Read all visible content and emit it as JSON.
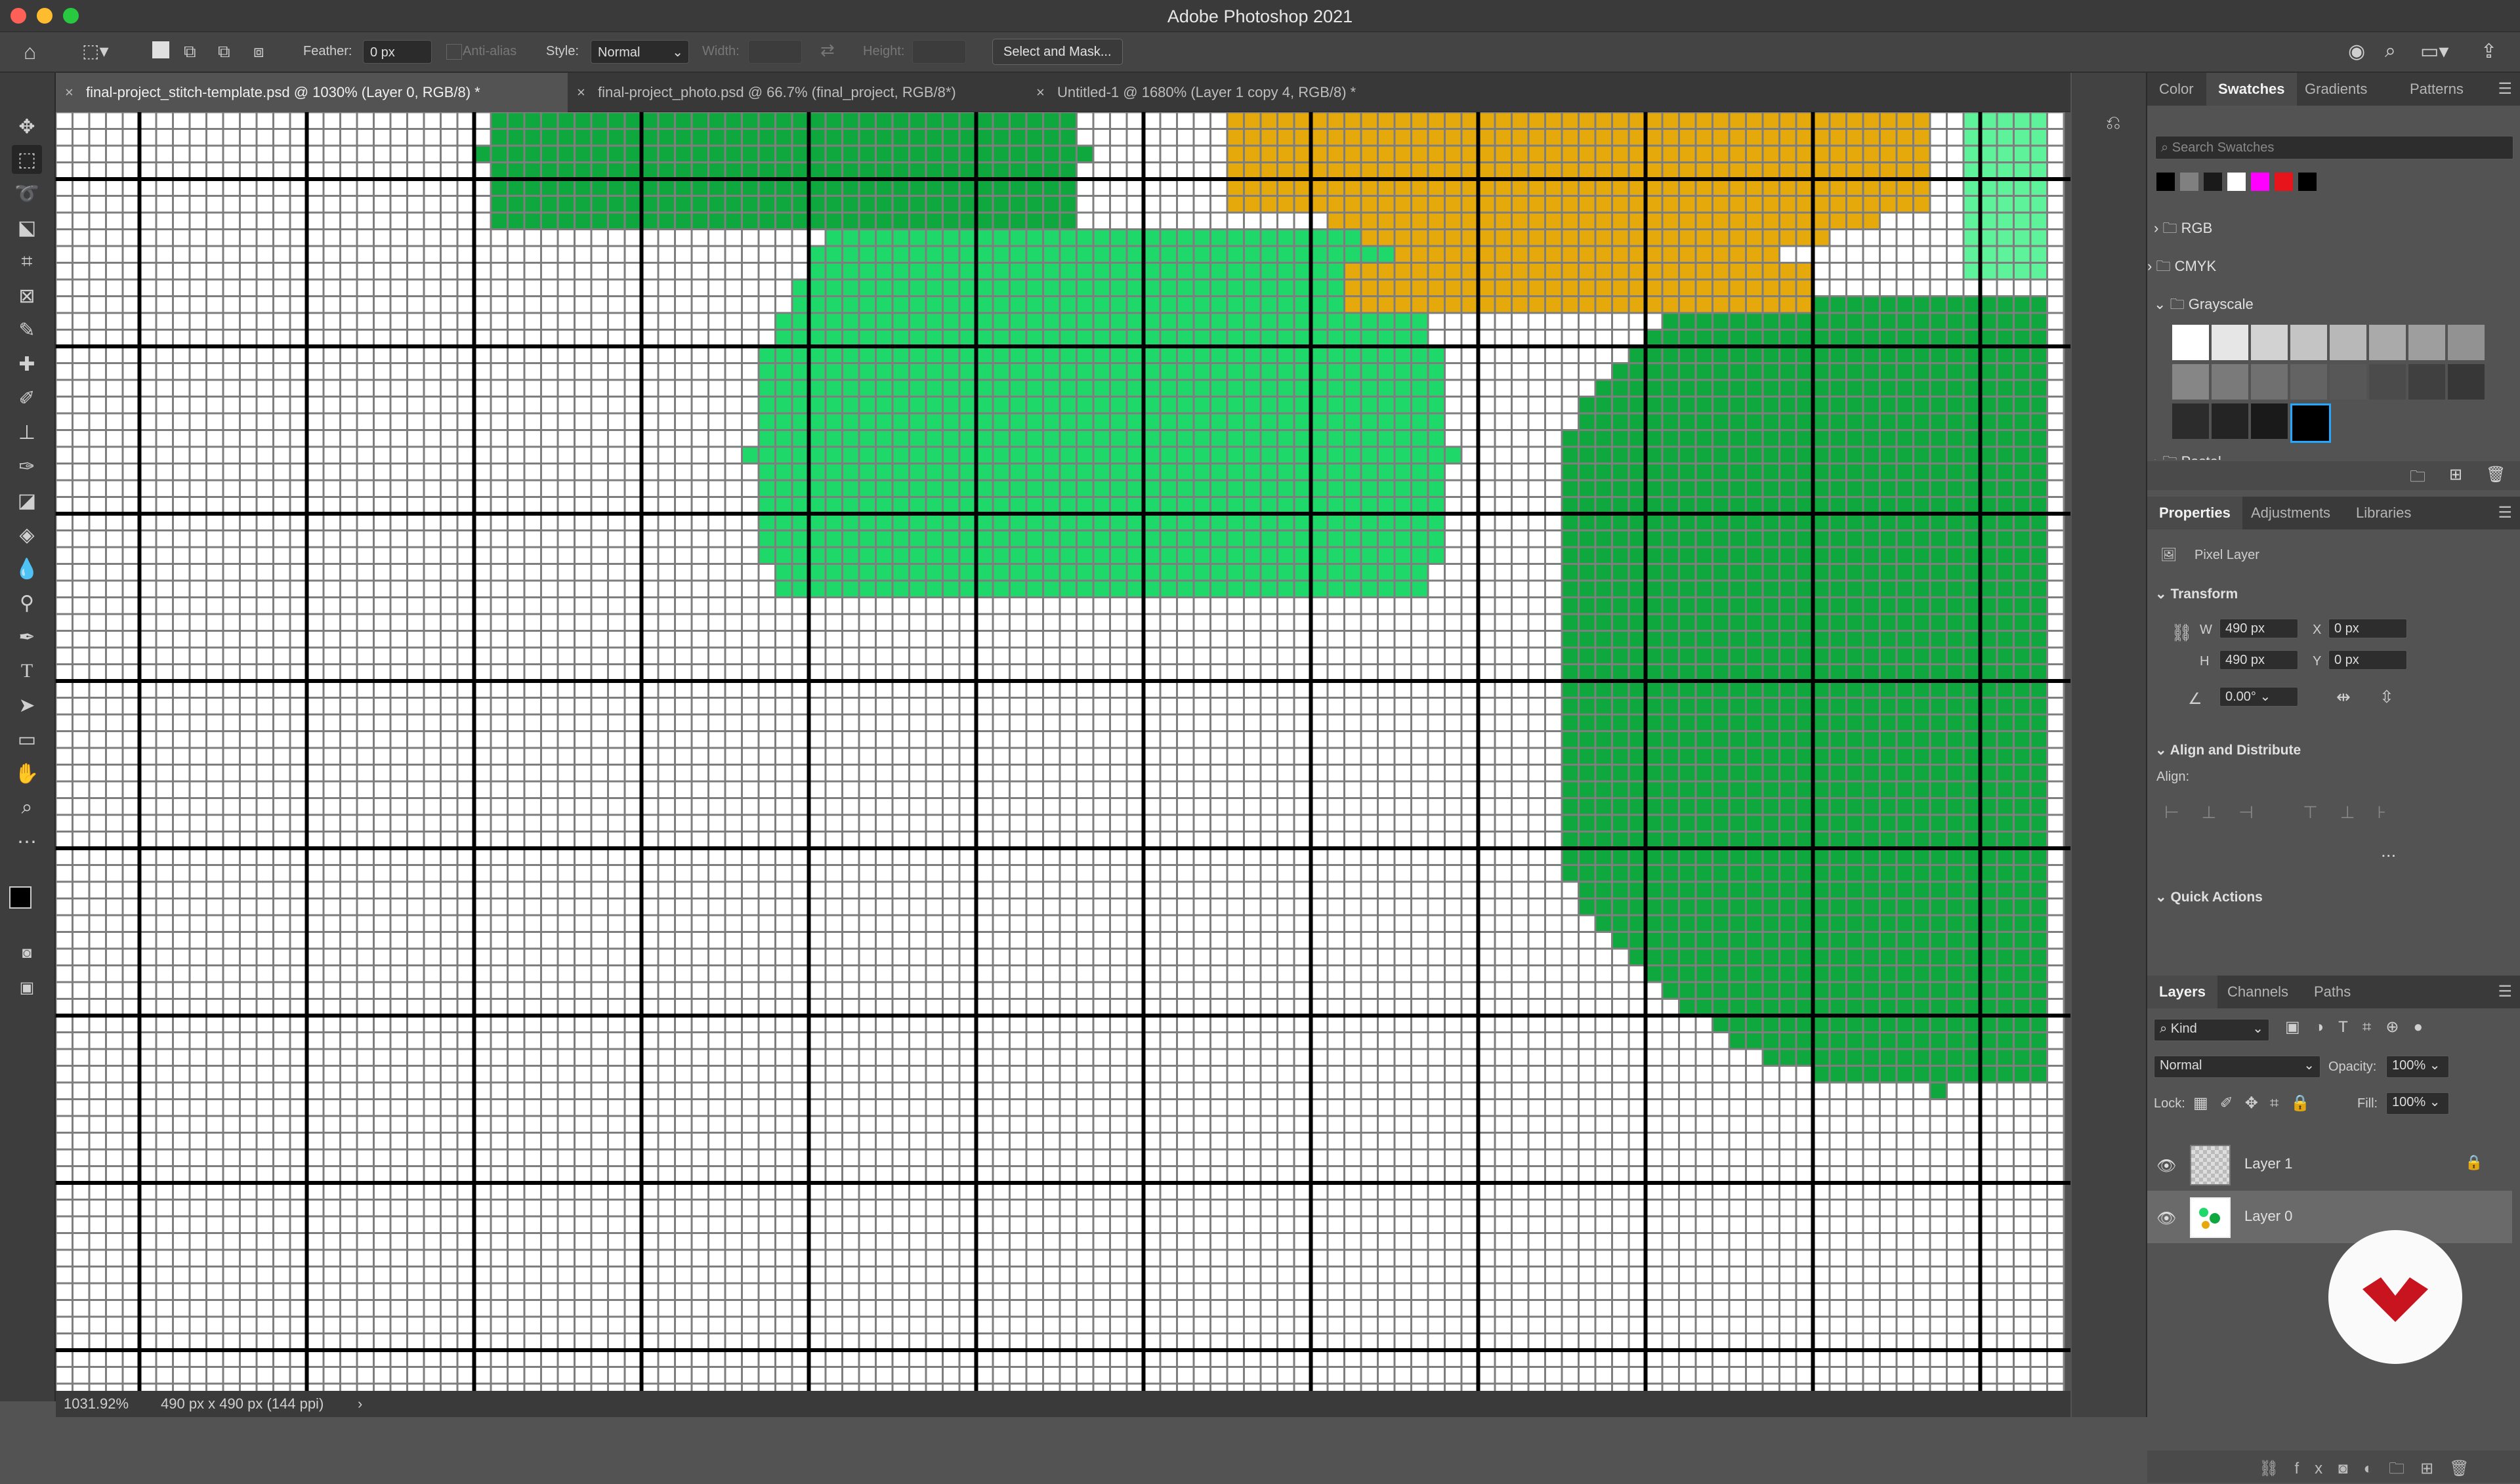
{
  "app": {
    "title": "Adobe Photoshop 2021"
  },
  "options": {
    "feather_label": "Feather:",
    "feather_value": "0 px",
    "antialias_label": "Anti-alias",
    "style_label": "Style:",
    "style_value": "Normal",
    "width_label": "Width:",
    "height_label": "Height:",
    "select_mask_label": "Select and Mask..."
  },
  "tabs": [
    {
      "label": "final-project_stitch-template.psd @ 1030% (Layer 0, RGB/8) *",
      "active": true
    },
    {
      "label": "final-project_photo.psd @ 66.7% (final_project, RGB/8*)",
      "active": false
    },
    {
      "label": "Untitled-1 @ 1680% (Layer 1 copy 4, RGB/8) *",
      "active": false
    }
  ],
  "status": {
    "zoom": "1031.92%",
    "doc_info": "490 px x 490 px (144 ppi)"
  },
  "swatches": {
    "tabs": [
      "Color",
      "Swatches",
      "Gradients",
      "Patterns"
    ],
    "search_placeholder": "Search Swatches",
    "recent_colors": [
      "#000000",
      "#808080",
      "#1a1a1a",
      "#ffffff",
      "#ff00ff",
      "#e8141c",
      "#000000"
    ],
    "groups": [
      "RGB",
      "CMYK",
      "Grayscale",
      "Pastel"
    ],
    "grayscale": [
      "#ffffff",
      "#e6e6e6",
      "#d2d2d2",
      "#c4c4c4",
      "#b8b8b8",
      "#aaaaaa",
      "#9e9e9e",
      "#929292",
      "#868686",
      "#7a7a7a",
      "#707070",
      "#636363",
      "#575757",
      "#4b4b4b",
      "#404040",
      "#373737",
      "#2c2c2c",
      "#242424",
      "#1a1a1a",
      "#000000"
    ]
  },
  "properties": {
    "tabs": [
      "Properties",
      "Adjustments",
      "Libraries"
    ],
    "layer_type": "Pixel Layer",
    "transform_title": "Transform",
    "w_label": "W",
    "w_value": "490 px",
    "h_label": "H",
    "h_value": "490 px",
    "x_label": "X",
    "x_value": "0 px",
    "y_label": "Y",
    "y_value": "0 px",
    "angle_value": "0.00°",
    "align_title": "Align and Distribute",
    "align_label": "Align:",
    "more": "...",
    "quick_actions": "Quick Actions"
  },
  "layers": {
    "tabs": [
      "Layers",
      "Channels",
      "Paths"
    ],
    "kind_label": "Kind",
    "blend_mode": "Normal",
    "opacity_label": "Opacity:",
    "opacity_value": "100%",
    "lock_label": "Lock:",
    "fill_label": "Fill:",
    "fill_value": "100%",
    "items": [
      {
        "name": "Layer 1",
        "locked": true,
        "selected": false
      },
      {
        "name": "Layer 0",
        "locked": false,
        "selected": true
      }
    ]
  },
  "colors": {
    "green_dark": "#0fa83f",
    "green_mid": "#1ed96a",
    "green_light": "#5ef29a",
    "green_pale": "#b6ecc8",
    "yellow": "#e6a90c",
    "yellow_pale": "#efd36a",
    "grid_line": "#7e7e7e",
    "major_grid": "#000000"
  }
}
